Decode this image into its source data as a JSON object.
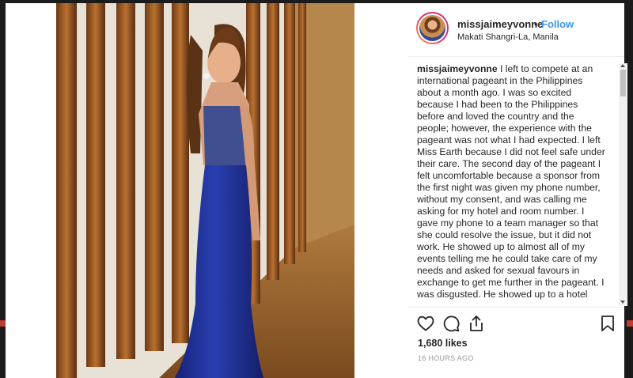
{
  "post": {
    "username": "missjaimeyvonne",
    "separator": "•",
    "follow_label": "Follow",
    "location": "Makati Shangri-La, Manila",
    "caption_username": "missjaimeyvonne",
    "caption_text": "I left to compete at an international pageant in the Philippines about a month ago. I was so excited because I had been to the Philippines before and loved the country and the people; however, the experience with the pageant was not what I had expected. I left Miss Earth because I did not feel safe under their care. The second day of the pageant I felt uncomfortable because a sponsor from the first night was given my phone number, without my consent, and was calling me asking for my hotel and room number. I gave my phone to a team manager so that she could resolve the issue, but it did not work. He showed up to almost all of my events telling me he could take care of my needs and asked for sexual favours in exchange to get me further in the pageant. I was disgusted. He showed up to a hotel",
    "likes": "1,680 likes",
    "timestamp": "16 HOURS AGO"
  },
  "icons": {
    "like": "heart-icon",
    "comment": "comment-icon",
    "share": "share-icon",
    "save": "bookmark-icon"
  },
  "colors": {
    "follow": "#3897f0",
    "text": "#262626",
    "muted": "#999999",
    "dress": "#1f2f8f"
  }
}
